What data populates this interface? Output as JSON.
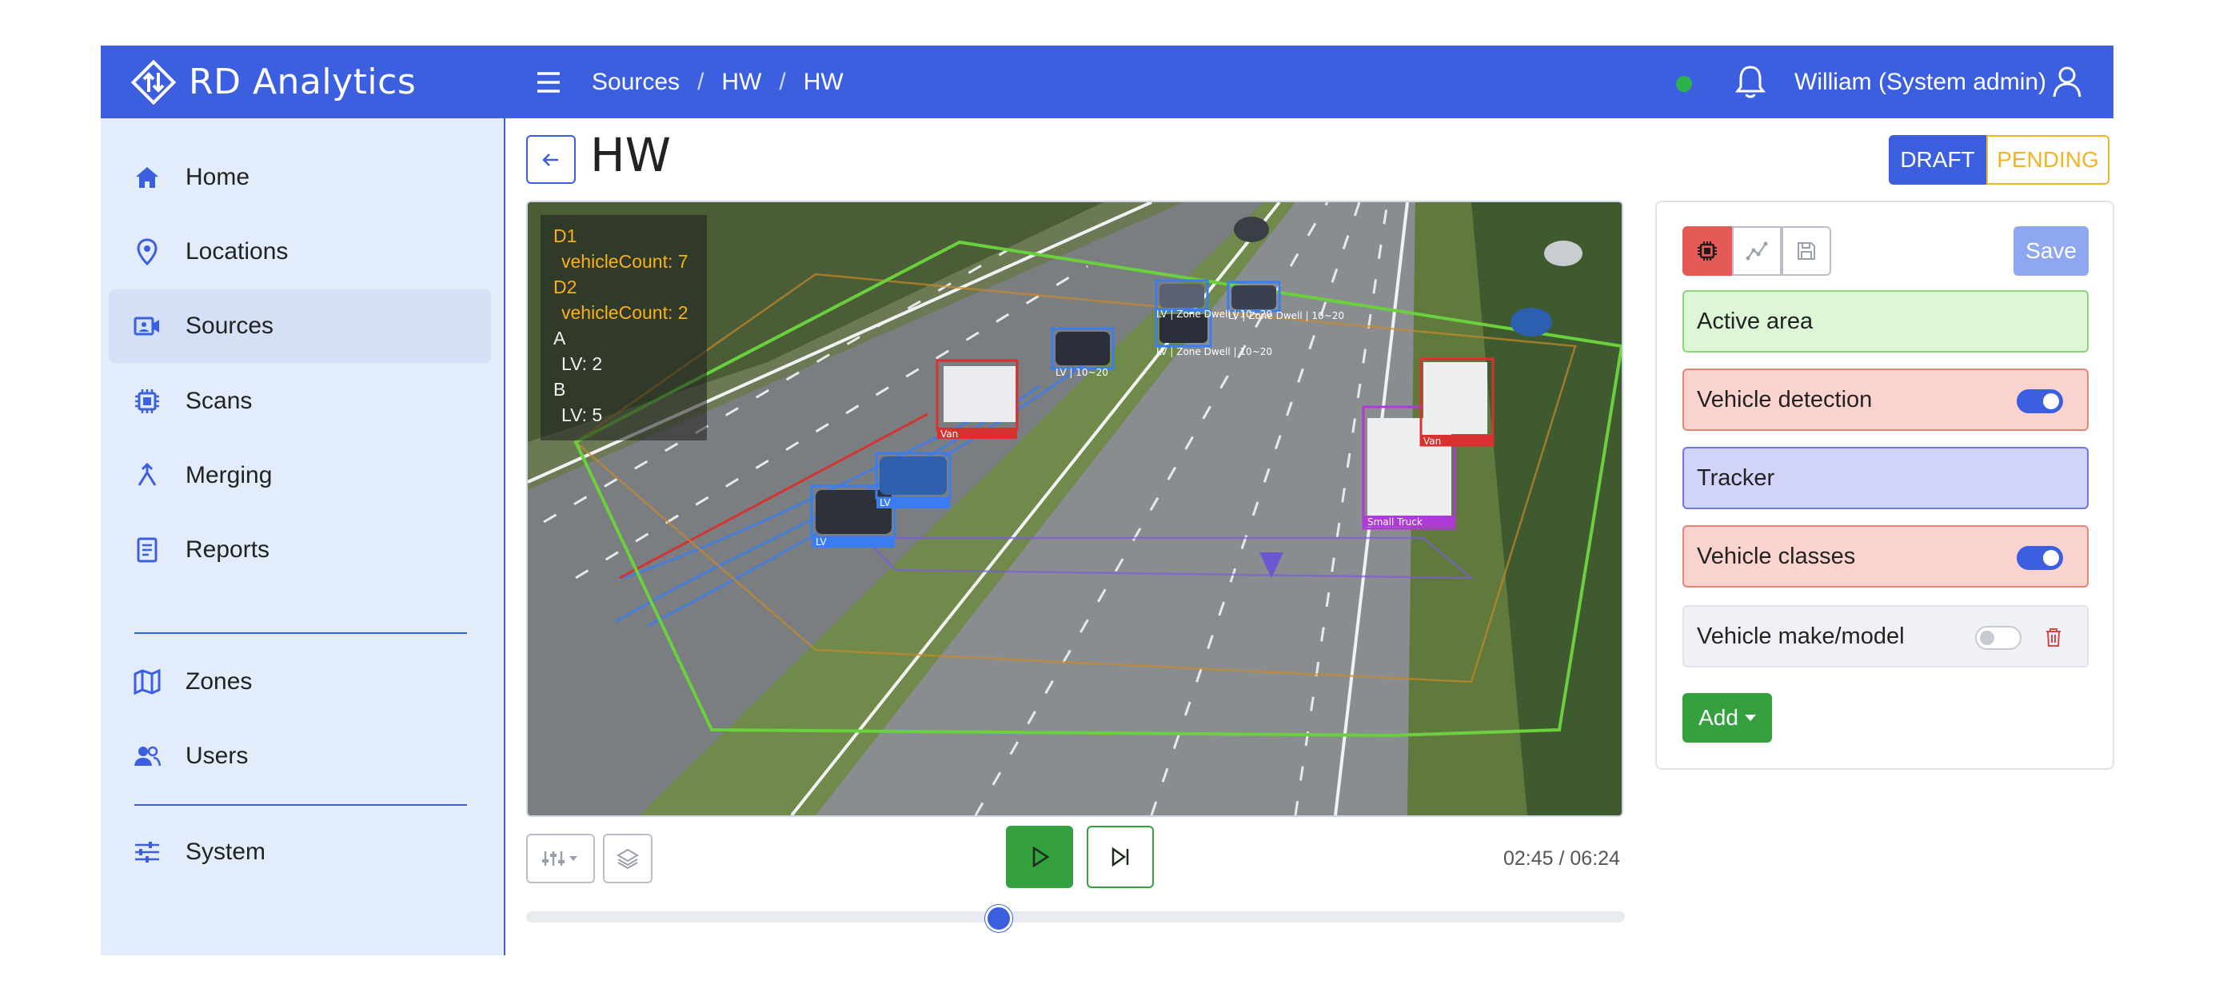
{
  "brand": {
    "name": "RD Analytics",
    "logo_icon": "diamond-arrows-logo",
    "color": "#3c5fe0"
  },
  "header": {
    "breadcrumb": [
      "Sources",
      "HW",
      "HW"
    ],
    "status_dot_color": "#2bb24c",
    "user": "William (System admin)"
  },
  "sidebar": {
    "items": [
      {
        "label": "Home",
        "icon": "home-icon"
      },
      {
        "label": "Locations",
        "icon": "map-pin-icon"
      },
      {
        "label": "Sources",
        "icon": "camera-icon",
        "active": true
      },
      {
        "label": "Scans",
        "icon": "chip-icon"
      },
      {
        "label": "Merging",
        "icon": "merge-icon"
      },
      {
        "label": "Reports",
        "icon": "report-icon"
      },
      {
        "label": "Zones",
        "icon": "map-icon"
      },
      {
        "label": "Users",
        "icon": "users-icon"
      },
      {
        "label": "System",
        "icon": "sliders-icon"
      }
    ]
  },
  "page": {
    "title": "HW",
    "status": {
      "draft": "DRAFT",
      "pending": "PENDING"
    }
  },
  "video": {
    "stats": {
      "d1": "D1",
      "d1_count": "vehicleCount: 7",
      "d2": "D2",
      "d2_count": "vehicleCount: 2",
      "a": "A",
      "a_lv": "LV: 2",
      "b": "B",
      "b_lv": "LV: 5"
    },
    "detections": [
      "Van",
      "LV",
      "LV",
      "LV | 10~20",
      "LV | Zone Dwell | 10~20",
      "LV | Zone Dwell | 10~20",
      "LV | Zone Dwell | 10~20",
      "Small Truck",
      "Van"
    ]
  },
  "player": {
    "time": "02:45 / 06:24",
    "progress": 0.43
  },
  "panel": {
    "save_label": "Save",
    "cards": {
      "active_area": "Active area",
      "vehicle_detection": "Vehicle detection",
      "tracker": "Tracker",
      "vehicle_classes": "Vehicle classes",
      "vehicle_make": "Vehicle make/model"
    },
    "add_label": "Add"
  }
}
